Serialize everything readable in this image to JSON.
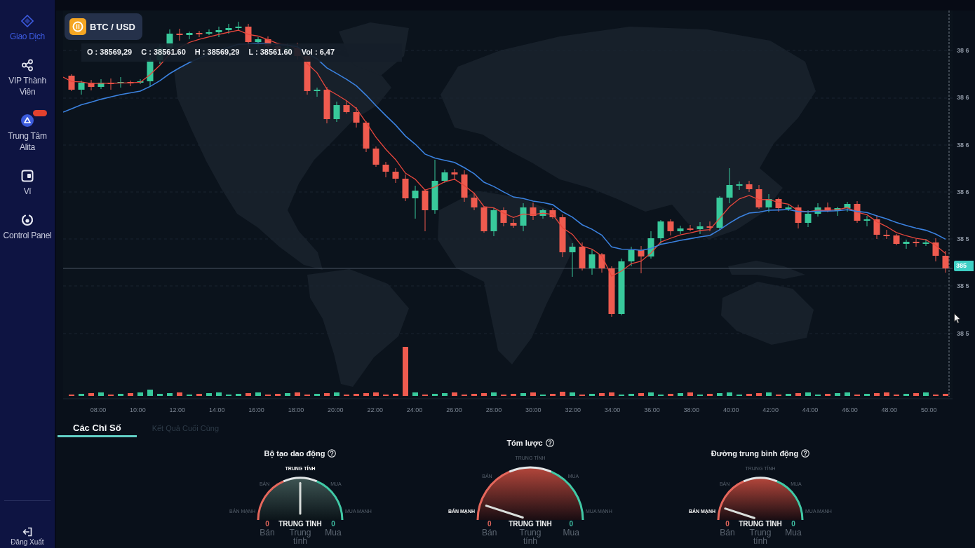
{
  "sidebar": {
    "items": [
      {
        "label": "Giao Dịch",
        "selected": true,
        "badge": false
      },
      {
        "label": "VIP Thành Viên",
        "selected": false,
        "badge": false
      },
      {
        "label": "Trung Tâm Alita",
        "selected": false,
        "badge": true
      },
      {
        "label": "Ví",
        "selected": false,
        "badge": false
      },
      {
        "label": "Control Panel",
        "selected": false,
        "badge": false
      }
    ],
    "logout": "Đăng Xuất"
  },
  "chart": {
    "symbol": "BTC / USD",
    "ohlc": [
      "O : 38569,29",
      "C : 38561.60",
      "H : 38569,29",
      "L : 38561.60",
      "Vol : 6,47"
    ],
    "price_axis": [
      "38 6",
      "38 6",
      "38 6",
      "38 6",
      "38 5",
      "38 5",
      "38 5"
    ],
    "current_price": "385",
    "time_axis": [
      "08:00",
      "10:00",
      "12:00",
      "14:00",
      "16:00",
      "18:00",
      "20:00",
      "22:00",
      "24:00",
      "26:00",
      "28:00",
      "30:00",
      "32:00",
      "34:00",
      "36:00",
      "38:00",
      "40:00",
      "42:00",
      "44:00",
      "46:00",
      "48:00",
      "50:00"
    ]
  },
  "tabs": [
    {
      "label": "Các Chỉ Số",
      "selected": true
    },
    {
      "label": "Kết Quả Cuối Cùng",
      "selected": false
    }
  ],
  "gauges": [
    {
      "kind": "detail",
      "title": "Bộ tạo dao động",
      "zones": [
        {
          "label": "BÁN MẠNH",
          "selected": false
        },
        {
          "label": "BÁN",
          "selected": false
        },
        {
          "label": "TRUNG TÍNH",
          "selected": true
        },
        {
          "label": "MUA",
          "selected": false
        },
        {
          "label": "MUA MẠNH",
          "selected": false
        }
      ],
      "result": "TRUNG TÍNH",
      "counts": [
        {
          "label": "Bán",
          "value": "0",
          "color": "#e0665c"
        },
        {
          "label": "Trung tính"
        },
        {
          "label": "Mua",
          "value": "0",
          "color": "#3fc1a5"
        }
      ]
    },
    {
      "kind": "summary",
      "title": "Tóm lược",
      "zones": [
        {
          "label": "BÁN MẠNH",
          "selected": true
        },
        {
          "label": "BÁN",
          "selected": false
        },
        {
          "label": "TRUNG TÍNH",
          "selected": false
        },
        {
          "label": "MUA",
          "selected": false
        },
        {
          "label": "MUA MẠNH",
          "selected": false
        }
      ],
      "result": "TRUNG TÍNH",
      "counts": [
        {
          "label": "Bán",
          "value": "0",
          "color": "#e0665c"
        },
        {
          "label": "Trung tính"
        },
        {
          "label": "Mua",
          "value": "0",
          "color": "#3fc1a5"
        }
      ]
    },
    {
      "kind": "detail",
      "title": "Đường trung bình động",
      "zones": [
        {
          "label": "BÁN MẠNH",
          "selected": true
        },
        {
          "label": "BÁN",
          "selected": false
        },
        {
          "label": "TRUNG TÍNH",
          "selected": false
        },
        {
          "label": "MUA",
          "selected": false
        },
        {
          "label": "MUA MẠNH",
          "selected": false
        }
      ],
      "result": "TRUNG TÍNH",
      "counts": [
        {
          "label": "Bán",
          "value": "0",
          "color": "#e0665c"
        },
        {
          "label": "Trung tính"
        },
        {
          "label": "Mua",
          "value": "0",
          "color": "#3fc1a5"
        }
      ]
    }
  ]
}
